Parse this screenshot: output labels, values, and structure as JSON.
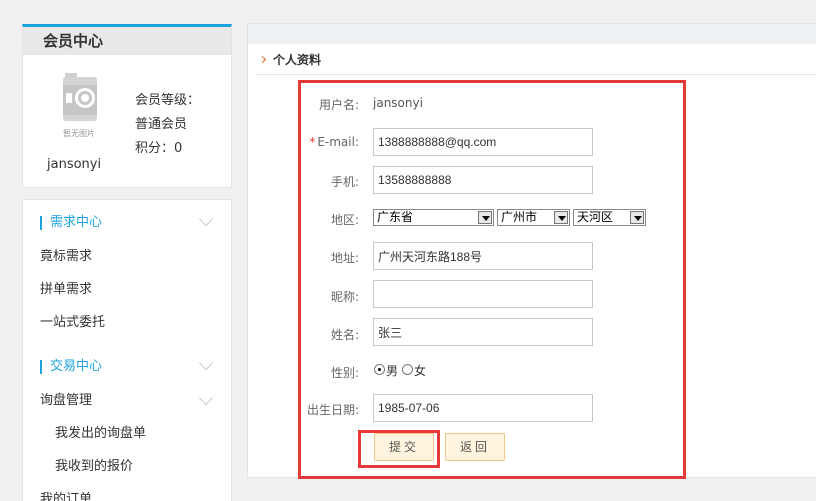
{
  "sidebar": {
    "card_title": "会员中心",
    "member_level_label": "会员等级：",
    "member_level": "普通会员",
    "points_label": "积分：",
    "points": "0",
    "avatar_caption": "暂无图片",
    "username": "jansonyi",
    "groups": [
      {
        "title": "需求中心",
        "items": [
          "竟标需求",
          "拼单需求",
          "一站式委托"
        ]
      },
      {
        "title": "交易中心",
        "items": [
          "询盘管理",
          "我发出的询盘单",
          "我收到的报价",
          "我的订单"
        ]
      }
    ]
  },
  "main": {
    "section_title": "个人资料",
    "form": {
      "username_label": "用户名:",
      "username_value": "jansonyi",
      "email_label": "E-mail:",
      "email_value": "1388888888@qq.com",
      "phone_label": "手机:",
      "phone_value": "13588888888",
      "region_label": "地区:",
      "province": "广东省",
      "city": "广州市",
      "district": "天河区",
      "address_label": "地址:",
      "address_value": "广州天河东路188号",
      "nickname_label": "昵称:",
      "nickname_value": "",
      "name_label": "姓名:",
      "name_value": "张三",
      "gender_label": "性别:",
      "gender_male": "男",
      "gender_female": "女",
      "gender_selected": "男",
      "birthday_label": "出生日期:",
      "birthday_value": "1985-07-06",
      "submit_label": "提交",
      "back_label": "返回"
    }
  },
  "colors": {
    "accent": "#1ba3e0",
    "highlight": "#e5393a",
    "button_bg": "#fff4dd"
  }
}
